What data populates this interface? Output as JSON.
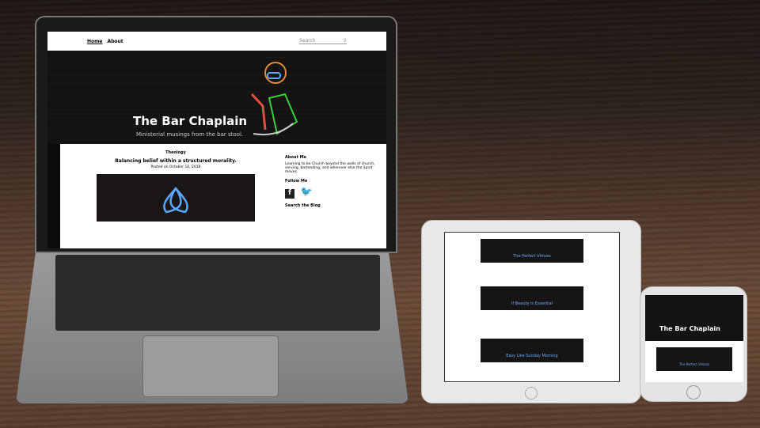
{
  "site": {
    "nav": {
      "items": [
        "Home",
        "About"
      ],
      "search_placeholder": "Search",
      "search_icon": "search-icon"
    },
    "title": "The Bar Chaplain",
    "tagline": "Ministerial musings from the bar stool.",
    "post": {
      "category": "Theology",
      "title": "Balancing belief within a structured morality.",
      "meta": "Posted on October 10, 2016"
    },
    "sidebar": {
      "about_heading": "About Me",
      "about_text": "Learning to be Church beyond the walls of church, serving, bartending, and wherever else the Spirit moves.",
      "follow_heading": "Follow Me",
      "social": [
        "facebook-icon",
        "twitter-icon"
      ],
      "search_heading": "Search the Blog"
    }
  },
  "tablet": {
    "posts": [
      "The Perfect Virtues",
      "If Beauty is Essential",
      "Easy Like Sunday Morning"
    ]
  },
  "phone": {
    "title": "The Bar Chaplain",
    "post": "The Perfect Virtues"
  },
  "colors": {
    "neon_blue": "#5aa8ff",
    "neon_green": "#3ccf3c",
    "neon_orange": "#e08a3a"
  }
}
